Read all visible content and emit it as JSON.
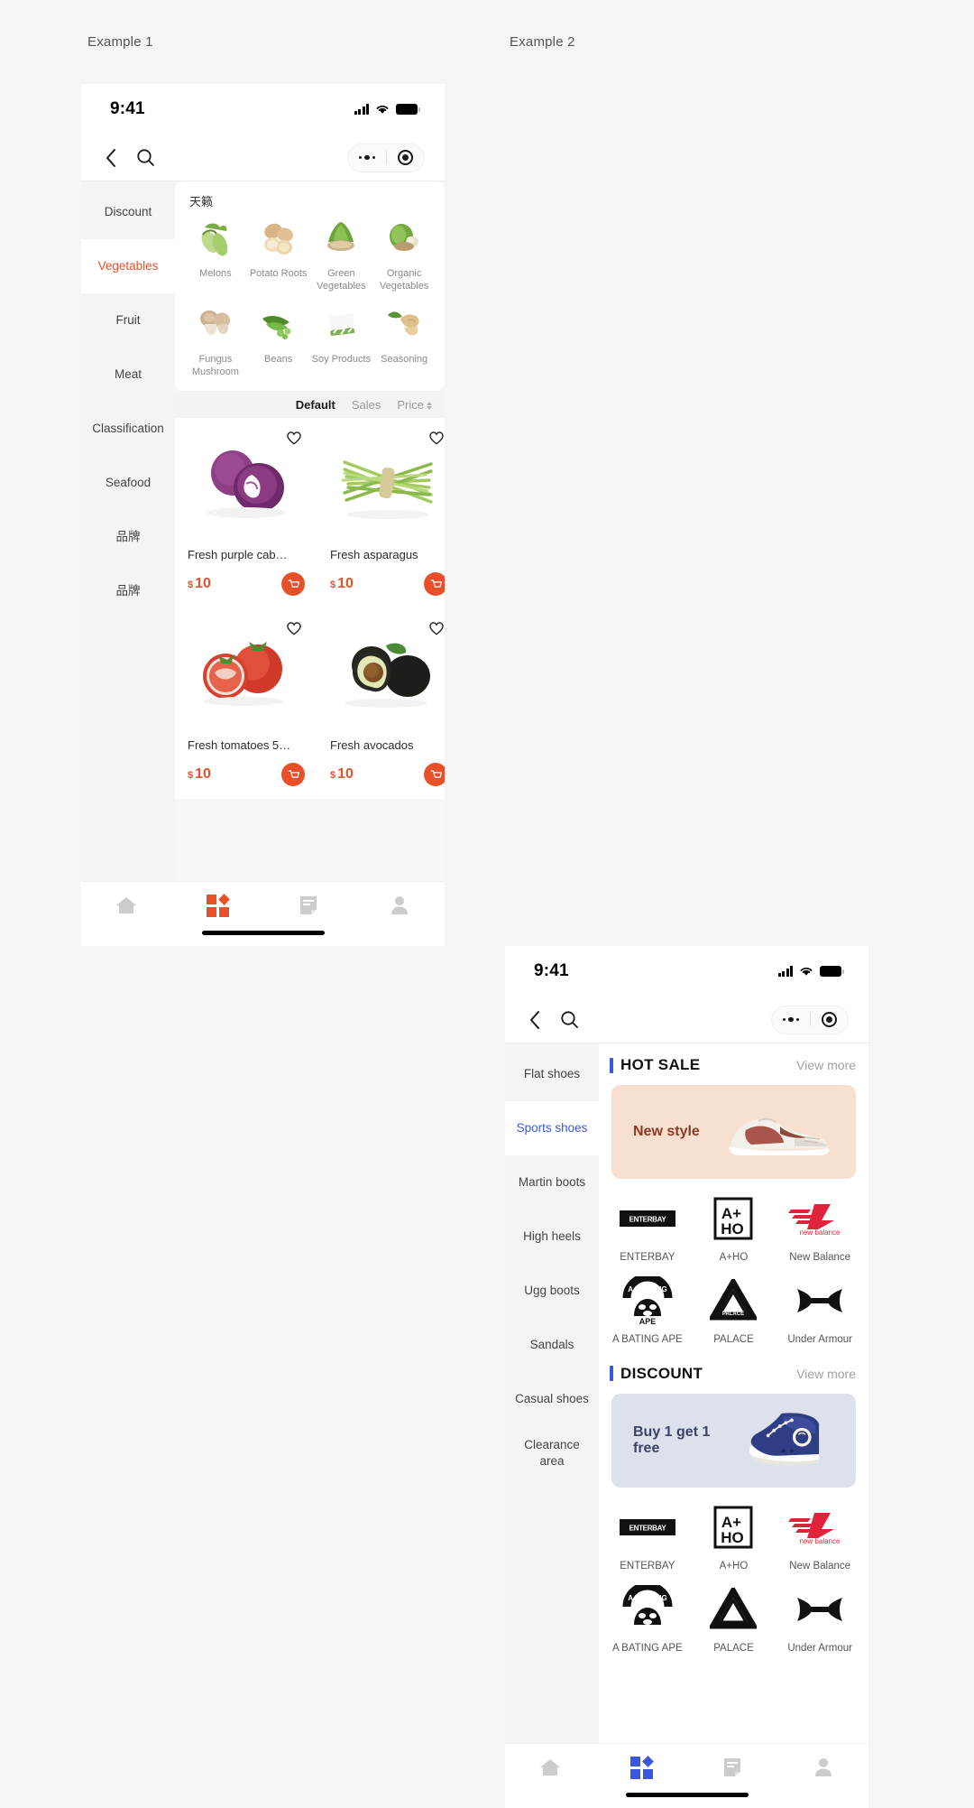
{
  "page": {
    "background": "#f5f5f5",
    "examples": [
      {
        "label": "Example 1"
      },
      {
        "label": "Example 2"
      }
    ]
  },
  "example1": {
    "accent": "#e8502a",
    "statusbar": {
      "time": "9:41",
      "signal_icon": "cellular-signal-icon",
      "wifi_icon": "wifi-icon",
      "battery_icon": "battery-icon"
    },
    "navbar": {
      "back_icon": "back-chevron-icon",
      "search_icon": "search-icon",
      "more_icon": "more-dots-icon",
      "target_icon": "target-circle-icon"
    },
    "sidebar": {
      "items": [
        {
          "label": "Discount",
          "active": false
        },
        {
          "label": "Vegetables",
          "active": true
        },
        {
          "label": "Fruit",
          "active": false
        },
        {
          "label": "Meat",
          "active": false
        },
        {
          "label": "Classification",
          "active": false
        },
        {
          "label": "Seafood",
          "active": false
        },
        {
          "label": "品牌",
          "active": false
        },
        {
          "label": "品牌",
          "active": false
        }
      ]
    },
    "category_panel": {
      "title": "天籁",
      "items": [
        {
          "label": "Melons",
          "icon": "melons-thumb"
        },
        {
          "label": "Potato Roots",
          "icon": "potato-roots-thumb"
        },
        {
          "label": "Green Vegetables",
          "icon": "green-vegetables-thumb"
        },
        {
          "label": "Organic Vegetables",
          "icon": "organic-vegetables-thumb"
        },
        {
          "label": "Fungus Mushroom",
          "icon": "fungus-mushroom-thumb"
        },
        {
          "label": "Beans",
          "icon": "beans-thumb"
        },
        {
          "label": "Soy Products",
          "icon": "soy-products-thumb"
        },
        {
          "label": "Seasoning",
          "icon": "seasoning-thumb"
        }
      ]
    },
    "sortbar": {
      "options": [
        {
          "label": "Default",
          "active": true
        },
        {
          "label": "Sales",
          "active": false
        },
        {
          "label": "Price",
          "active": false,
          "has_sort_arrows": true
        }
      ]
    },
    "products": [
      {
        "name": "Fresh purple cab…",
        "currency": "$",
        "price": "10",
        "image": "purple-cabbage-image",
        "favorite_icon": "heart-outline-icon",
        "cart_icon": "cart-icon"
      },
      {
        "name": "Fresh asparagus",
        "currency": "$",
        "price": "10",
        "image": "asparagus-image",
        "favorite_icon": "heart-outline-icon",
        "cart_icon": "cart-icon"
      },
      {
        "name": "Fresh tomatoes 5…",
        "currency": "$",
        "price": "10",
        "image": "tomatoes-image",
        "favorite_icon": "heart-outline-icon",
        "cart_icon": "cart-icon"
      },
      {
        "name": "Fresh avocados",
        "currency": "$",
        "price": "10",
        "image": "avocado-image",
        "favorite_icon": "heart-outline-icon",
        "cart_icon": "cart-icon"
      }
    ],
    "tabbar": {
      "items": [
        {
          "icon": "home-icon",
          "active": false
        },
        {
          "icon": "category-grid-icon",
          "active": true
        },
        {
          "icon": "orders-document-icon",
          "active": false
        },
        {
          "icon": "profile-person-icon",
          "active": false
        }
      ]
    }
  },
  "example2": {
    "accent": "#3b57e0",
    "statusbar": {
      "time": "9:41",
      "signal_icon": "cellular-signal-icon",
      "wifi_icon": "wifi-icon",
      "battery_icon": "battery-icon"
    },
    "navbar": {
      "back_icon": "back-chevron-icon",
      "search_icon": "search-icon",
      "more_icon": "more-dots-icon",
      "target_icon": "target-circle-icon"
    },
    "sidebar": {
      "items": [
        {
          "label": "Flat shoes",
          "active": false
        },
        {
          "label": "Sports shoes",
          "active": true
        },
        {
          "label": "Martin boots",
          "active": false
        },
        {
          "label": "High heels",
          "active": false
        },
        {
          "label": "Ugg boots",
          "active": false
        },
        {
          "label": "Sandals",
          "active": false
        },
        {
          "label": "Casual shoes",
          "active": false
        },
        {
          "label": "Clearance area",
          "active": false
        }
      ]
    },
    "sections": [
      {
        "title": "HOT SALE",
        "view_more": "View more",
        "banner": {
          "text": "New style",
          "bg": "#f8e0d0",
          "text_color": "#8a3a28",
          "image": "running-shoe-image"
        },
        "brands": [
          {
            "name": "ENTERBAY",
            "logo": "enterbay-logo"
          },
          {
            "name": "A+HO",
            "logo": "a-plus-ho-logo"
          },
          {
            "name": "New Balance",
            "logo": "new-balance-logo"
          },
          {
            "name": "A BATING APE",
            "logo": "a-bathing-ape-logo"
          },
          {
            "name": "PALACE",
            "logo": "palace-logo"
          },
          {
            "name": "Under Armour",
            "logo": "under-armour-logo"
          }
        ]
      },
      {
        "title": "DISCOUNT",
        "view_more": "View more",
        "banner": {
          "text": "Buy 1 get 1 free",
          "bg": "#dde1ec",
          "text_color": "#3a4468",
          "image": "blue-high-top-sneaker-image"
        },
        "brands": [
          {
            "name": "ENTERBAY",
            "logo": "enterbay-logo"
          },
          {
            "name": "A+HO",
            "logo": "a-plus-ho-logo"
          },
          {
            "name": "New Balance",
            "logo": "new-balance-logo"
          },
          {
            "name": "A BATING APE",
            "logo": "a-bathing-ape-logo"
          },
          {
            "name": "PALACE",
            "logo": "palace-logo"
          },
          {
            "name": "Under Armour",
            "logo": "under-armour-logo"
          }
        ]
      }
    ],
    "tabbar": {
      "items": [
        {
          "icon": "home-icon",
          "active": false
        },
        {
          "icon": "category-grid-icon",
          "active": true
        },
        {
          "icon": "orders-document-icon",
          "active": false
        },
        {
          "icon": "profile-person-icon",
          "active": false
        }
      ]
    }
  }
}
